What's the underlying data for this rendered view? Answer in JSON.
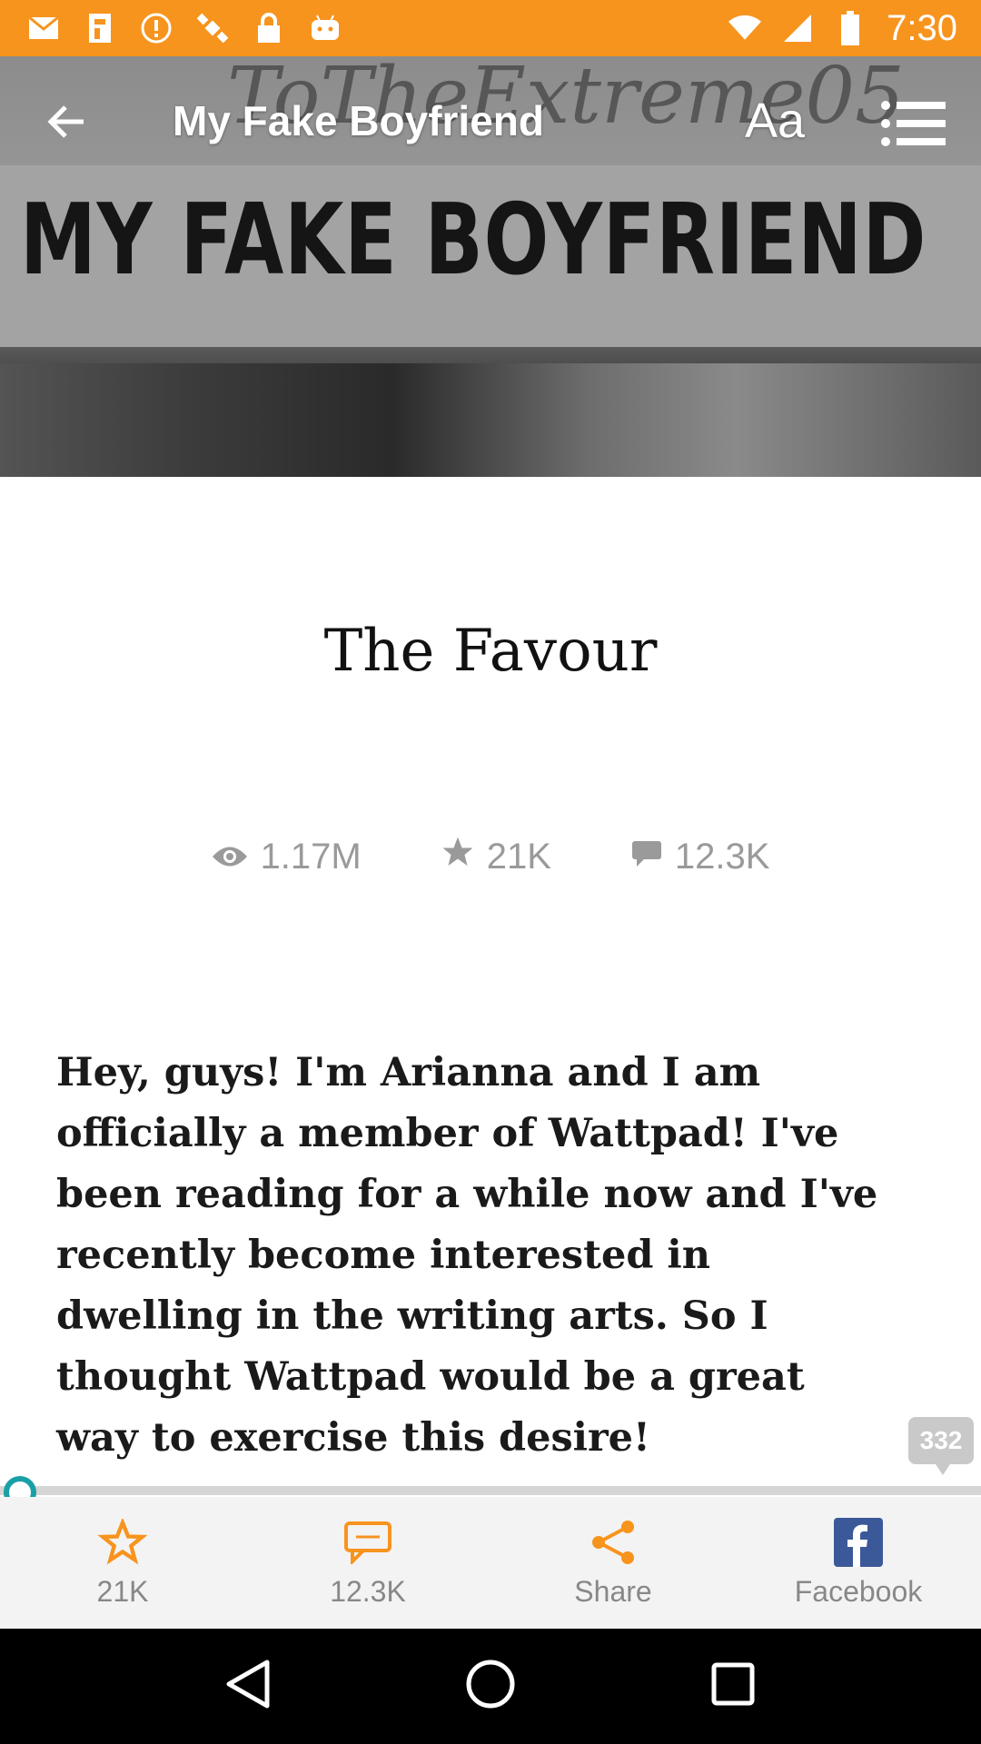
{
  "status_bar": {
    "time": "7:30",
    "left_icons": [
      "mail-icon",
      "fake-gps-icon",
      "alert-icon",
      "satellite-icon",
      "lock-icon",
      "android-icon"
    ],
    "right_icons": [
      "wifi-icon",
      "signal-icon",
      "battery-icon"
    ]
  },
  "cover": {
    "script_text": "ToTheExtreme05",
    "title_text": "MY FAKE BOYFRIEND"
  },
  "appbar": {
    "title": "My Fake Boyfriend",
    "font_button": "Aa"
  },
  "chapter": {
    "title": "The Favour",
    "stats": {
      "views": "1.17M",
      "votes": "21K",
      "comments": "12.3K"
    },
    "paragraph": "Hey, guys! I'm Arianna and I am officially a member of Wattpad! I've been reading for a while now and I've recently become interested in dwelling in the writing arts. So I thought Wattpad would be a great way to exercise this desire!",
    "paragraph_comment_count": "332"
  },
  "reading_progress": 0.0,
  "action_bar": {
    "vote": "21K",
    "comment": "12.3K",
    "share": "Share",
    "facebook": "Facebook"
  },
  "colors": {
    "status_bar": "#f7941d",
    "accent_orange": "#f7941d",
    "progress": "#19a0a6",
    "facebook": "#3b5998"
  }
}
